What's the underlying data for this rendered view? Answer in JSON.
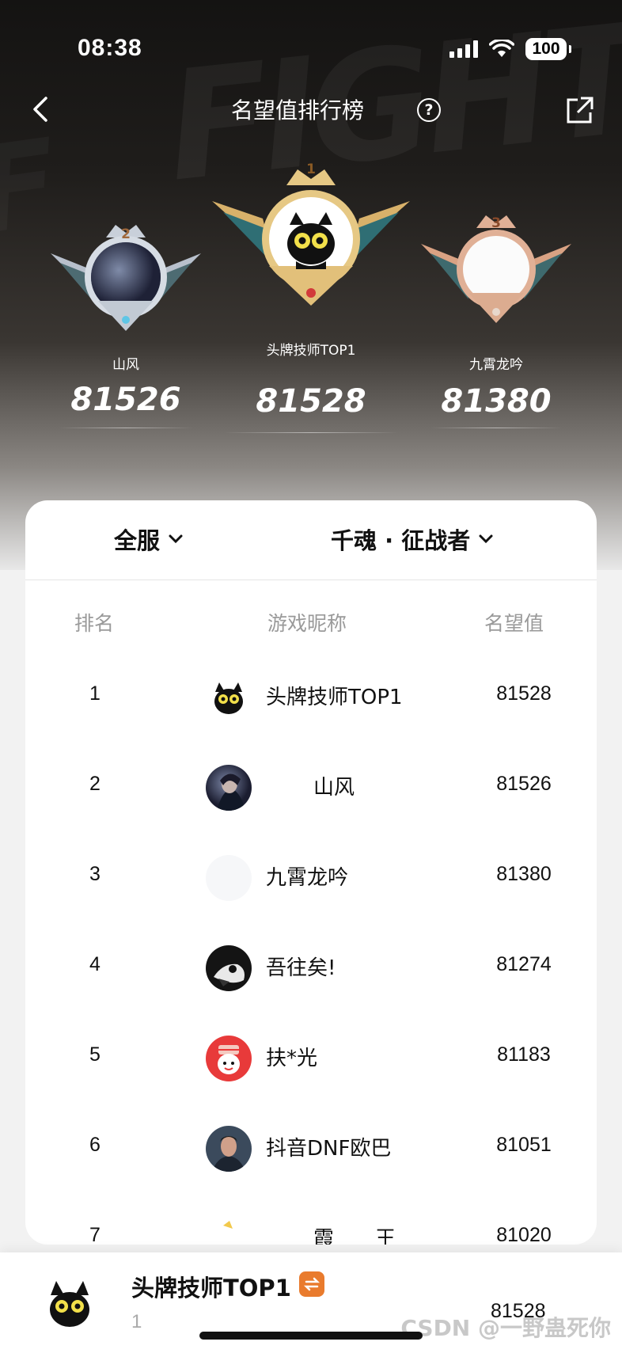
{
  "status_bar": {
    "time": "08:38",
    "battery": "100"
  },
  "nav": {
    "title": "名望值排行榜",
    "help": "?"
  },
  "podium": [
    {
      "rank": "2",
      "name": "山风",
      "score": "81526"
    },
    {
      "rank": "1",
      "name": "头牌技师TOP1",
      "score": "81528"
    },
    {
      "rank": "3",
      "name": "九霄龙吟",
      "score": "81380"
    }
  ],
  "filters": {
    "server": "全服",
    "class": "千魂 · 征战者"
  },
  "table": {
    "headers": {
      "rank": "排名",
      "name": "游戏昵称",
      "score": "名望值"
    },
    "rows": [
      {
        "rank": "1",
        "name": "头牌技师TOP1",
        "score": "81528",
        "avatar": "black-cat"
      },
      {
        "rank": "2",
        "name": "山风",
        "score": "81526",
        "avatar": "dark-anime"
      },
      {
        "rank": "3",
        "name": "九霄龙吟",
        "score": "81380",
        "avatar": "blank"
      },
      {
        "rank": "4",
        "name": "吾往矣!",
        "score": "81274",
        "avatar": "dark-figure"
      },
      {
        "rank": "5",
        "name": "扶*光",
        "score": "81183",
        "avatar": "red-character"
      },
      {
        "rank": "6",
        "name": "抖音DNF欧巴",
        "score": "81051",
        "avatar": "portrait"
      },
      {
        "rank": "7",
        "name": "霞　　王",
        "score": "81020",
        "avatar": "cartoon"
      }
    ]
  },
  "me": {
    "name": "头牌技师TOP1",
    "rank": "1",
    "score": "81528"
  },
  "watermark": "CSDN @一野蛊死你",
  "colors": {
    "badge": "#e97b2d",
    "gold": "#d8b16a",
    "silver": "#b8c0cc",
    "bronze": "#d9a283"
  }
}
